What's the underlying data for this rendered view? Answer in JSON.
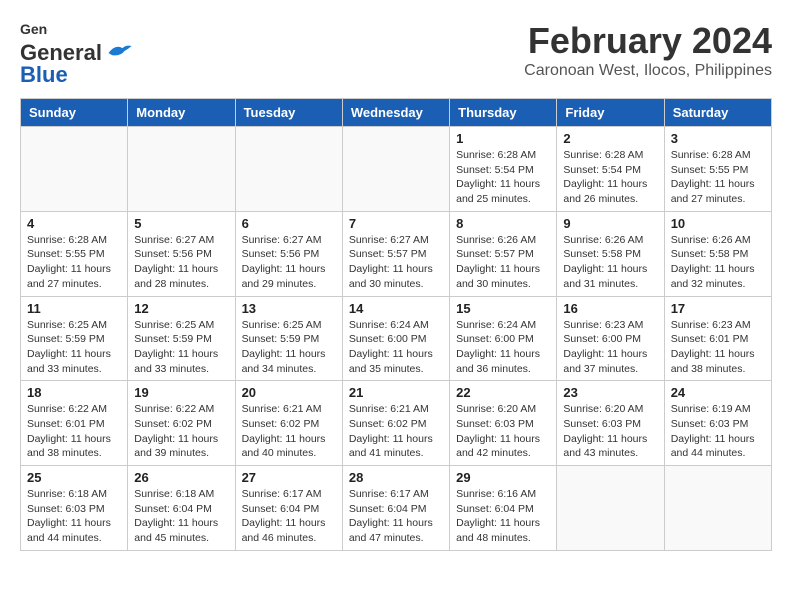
{
  "logo": {
    "line1": "General",
    "line2": "Blue"
  },
  "title": "February 2024",
  "subtitle": "Caronoan West, Ilocos, Philippines",
  "weekdays": [
    "Sunday",
    "Monday",
    "Tuesday",
    "Wednesday",
    "Thursday",
    "Friday",
    "Saturday"
  ],
  "weeks": [
    [
      {
        "day": "",
        "info": ""
      },
      {
        "day": "",
        "info": ""
      },
      {
        "day": "",
        "info": ""
      },
      {
        "day": "",
        "info": ""
      },
      {
        "day": "1",
        "info": "Sunrise: 6:28 AM\nSunset: 5:54 PM\nDaylight: 11 hours\nand 25 minutes."
      },
      {
        "day": "2",
        "info": "Sunrise: 6:28 AM\nSunset: 5:54 PM\nDaylight: 11 hours\nand 26 minutes."
      },
      {
        "day": "3",
        "info": "Sunrise: 6:28 AM\nSunset: 5:55 PM\nDaylight: 11 hours\nand 27 minutes."
      }
    ],
    [
      {
        "day": "4",
        "info": "Sunrise: 6:28 AM\nSunset: 5:55 PM\nDaylight: 11 hours\nand 27 minutes."
      },
      {
        "day": "5",
        "info": "Sunrise: 6:27 AM\nSunset: 5:56 PM\nDaylight: 11 hours\nand 28 minutes."
      },
      {
        "day": "6",
        "info": "Sunrise: 6:27 AM\nSunset: 5:56 PM\nDaylight: 11 hours\nand 29 minutes."
      },
      {
        "day": "7",
        "info": "Sunrise: 6:27 AM\nSunset: 5:57 PM\nDaylight: 11 hours\nand 30 minutes."
      },
      {
        "day": "8",
        "info": "Sunrise: 6:26 AM\nSunset: 5:57 PM\nDaylight: 11 hours\nand 30 minutes."
      },
      {
        "day": "9",
        "info": "Sunrise: 6:26 AM\nSunset: 5:58 PM\nDaylight: 11 hours\nand 31 minutes."
      },
      {
        "day": "10",
        "info": "Sunrise: 6:26 AM\nSunset: 5:58 PM\nDaylight: 11 hours\nand 32 minutes."
      }
    ],
    [
      {
        "day": "11",
        "info": "Sunrise: 6:25 AM\nSunset: 5:59 PM\nDaylight: 11 hours\nand 33 minutes."
      },
      {
        "day": "12",
        "info": "Sunrise: 6:25 AM\nSunset: 5:59 PM\nDaylight: 11 hours\nand 33 minutes."
      },
      {
        "day": "13",
        "info": "Sunrise: 6:25 AM\nSunset: 5:59 PM\nDaylight: 11 hours\nand 34 minutes."
      },
      {
        "day": "14",
        "info": "Sunrise: 6:24 AM\nSunset: 6:00 PM\nDaylight: 11 hours\nand 35 minutes."
      },
      {
        "day": "15",
        "info": "Sunrise: 6:24 AM\nSunset: 6:00 PM\nDaylight: 11 hours\nand 36 minutes."
      },
      {
        "day": "16",
        "info": "Sunrise: 6:23 AM\nSunset: 6:00 PM\nDaylight: 11 hours\nand 37 minutes."
      },
      {
        "day": "17",
        "info": "Sunrise: 6:23 AM\nSunset: 6:01 PM\nDaylight: 11 hours\nand 38 minutes."
      }
    ],
    [
      {
        "day": "18",
        "info": "Sunrise: 6:22 AM\nSunset: 6:01 PM\nDaylight: 11 hours\nand 38 minutes."
      },
      {
        "day": "19",
        "info": "Sunrise: 6:22 AM\nSunset: 6:02 PM\nDaylight: 11 hours\nand 39 minutes."
      },
      {
        "day": "20",
        "info": "Sunrise: 6:21 AM\nSunset: 6:02 PM\nDaylight: 11 hours\nand 40 minutes."
      },
      {
        "day": "21",
        "info": "Sunrise: 6:21 AM\nSunset: 6:02 PM\nDaylight: 11 hours\nand 41 minutes."
      },
      {
        "day": "22",
        "info": "Sunrise: 6:20 AM\nSunset: 6:03 PM\nDaylight: 11 hours\nand 42 minutes."
      },
      {
        "day": "23",
        "info": "Sunrise: 6:20 AM\nSunset: 6:03 PM\nDaylight: 11 hours\nand 43 minutes."
      },
      {
        "day": "24",
        "info": "Sunrise: 6:19 AM\nSunset: 6:03 PM\nDaylight: 11 hours\nand 44 minutes."
      }
    ],
    [
      {
        "day": "25",
        "info": "Sunrise: 6:18 AM\nSunset: 6:03 PM\nDaylight: 11 hours\nand 44 minutes."
      },
      {
        "day": "26",
        "info": "Sunrise: 6:18 AM\nSunset: 6:04 PM\nDaylight: 11 hours\nand 45 minutes."
      },
      {
        "day": "27",
        "info": "Sunrise: 6:17 AM\nSunset: 6:04 PM\nDaylight: 11 hours\nand 46 minutes."
      },
      {
        "day": "28",
        "info": "Sunrise: 6:17 AM\nSunset: 6:04 PM\nDaylight: 11 hours\nand 47 minutes."
      },
      {
        "day": "29",
        "info": "Sunrise: 6:16 AM\nSunset: 6:04 PM\nDaylight: 11 hours\nand 48 minutes."
      },
      {
        "day": "",
        "info": ""
      },
      {
        "day": "",
        "info": ""
      }
    ]
  ]
}
